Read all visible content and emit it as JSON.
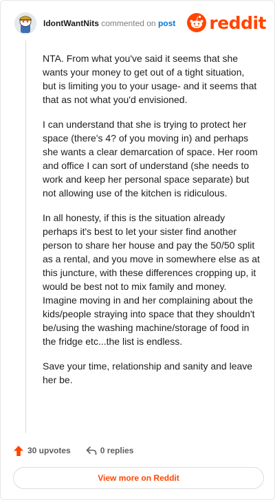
{
  "header": {
    "username": "IdontWantNits",
    "commented_text": "commented on",
    "post_link": "post",
    "brand": "reddit",
    "brand_color": "#ff4500",
    "avatar_icon": "snoo-avatar-icon",
    "logo_icon": "reddit-alien-icon"
  },
  "comment": {
    "paragraphs": [
      "NTA. From what you've said it seems that she wants your money to get out of a tight situation, but is limiting you to your usage- and it seems that that as not what you'd envisioned.",
      "I can understand that she is trying to protect her space (there's 4? of you moving in) and perhaps she wants a clear demarcation of space. Her room and office I can sort of understand (she needs to work and keep her personal space separate) but not allowing use of the kitchen is ridiculous.",
      "In all honesty, if this is the situation already perhaps it's best to let your sister find another person to share her house and pay the 50/50 split as a rental, and you move in somewhere else as at this juncture, with these differences cropping up, it would be best not to mix family and money. Imagine moving in and her complaining about the kids/people straying into space that they shouldn't be/using the washing machine/storage of food in the fridge etc...the list is endless.",
      "Save your time, relationship and sanity and leave her be."
    ]
  },
  "actions": {
    "upvotes": "30 upvotes",
    "replies": "0 replies",
    "upvote_icon": "upvote-arrow-icon",
    "reply_icon": "reply-arrow-icon"
  },
  "footer": {
    "view_more": "View more on Reddit"
  }
}
